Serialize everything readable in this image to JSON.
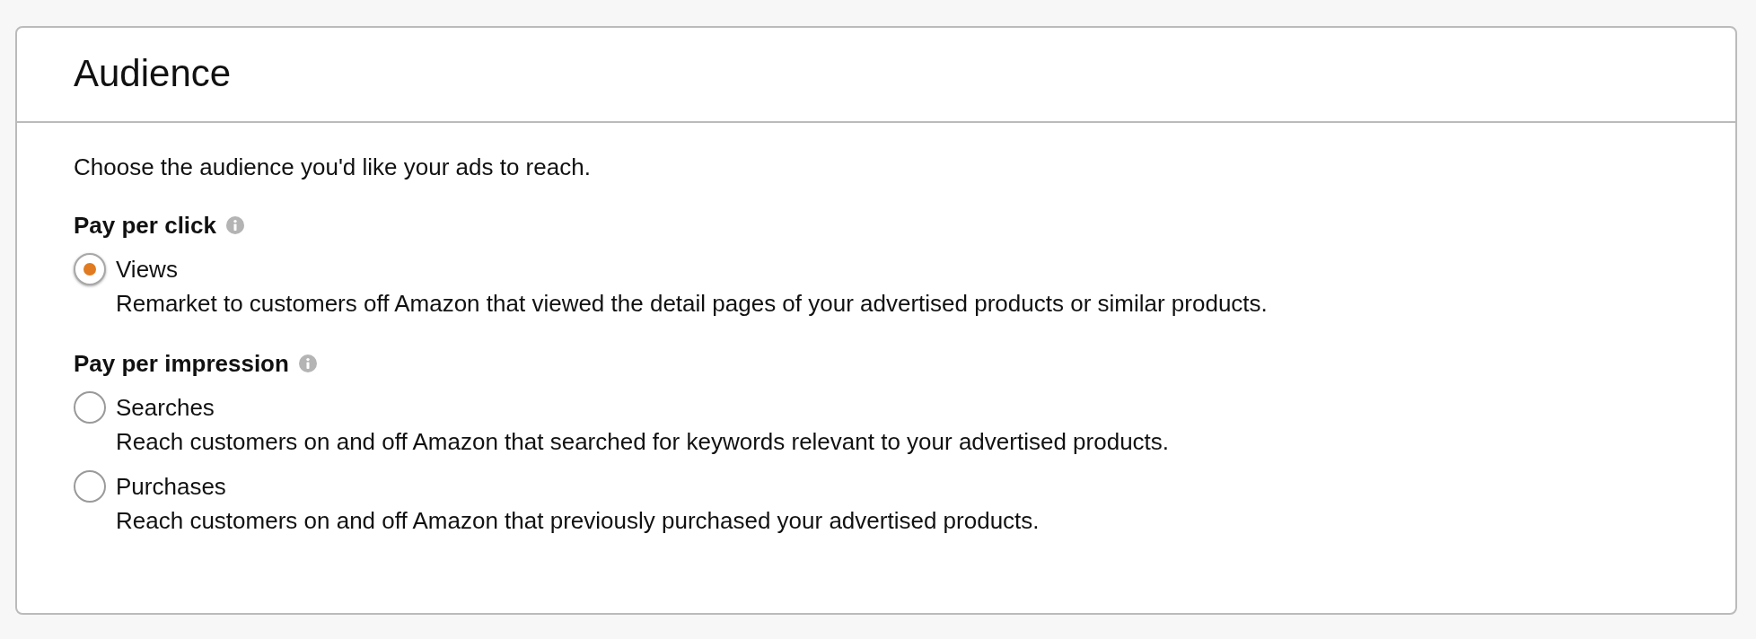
{
  "card": {
    "title": "Audience"
  },
  "intro": "Choose the audience you'd like your ads to reach.",
  "groups": [
    {
      "label": "Pay per click",
      "options": [
        {
          "label": "Views",
          "description": "Remarket to customers off Amazon that viewed the detail pages of your advertised products or similar products.",
          "selected": true
        }
      ]
    },
    {
      "label": "Pay per impression",
      "options": [
        {
          "label": "Searches",
          "description": "Reach customers on and off Amazon that searched for keywords relevant to your advertised products.",
          "selected": false
        },
        {
          "label": "Purchases",
          "description": "Reach customers on and off Amazon that previously purchased your advertised products.",
          "selected": false
        }
      ]
    }
  ]
}
